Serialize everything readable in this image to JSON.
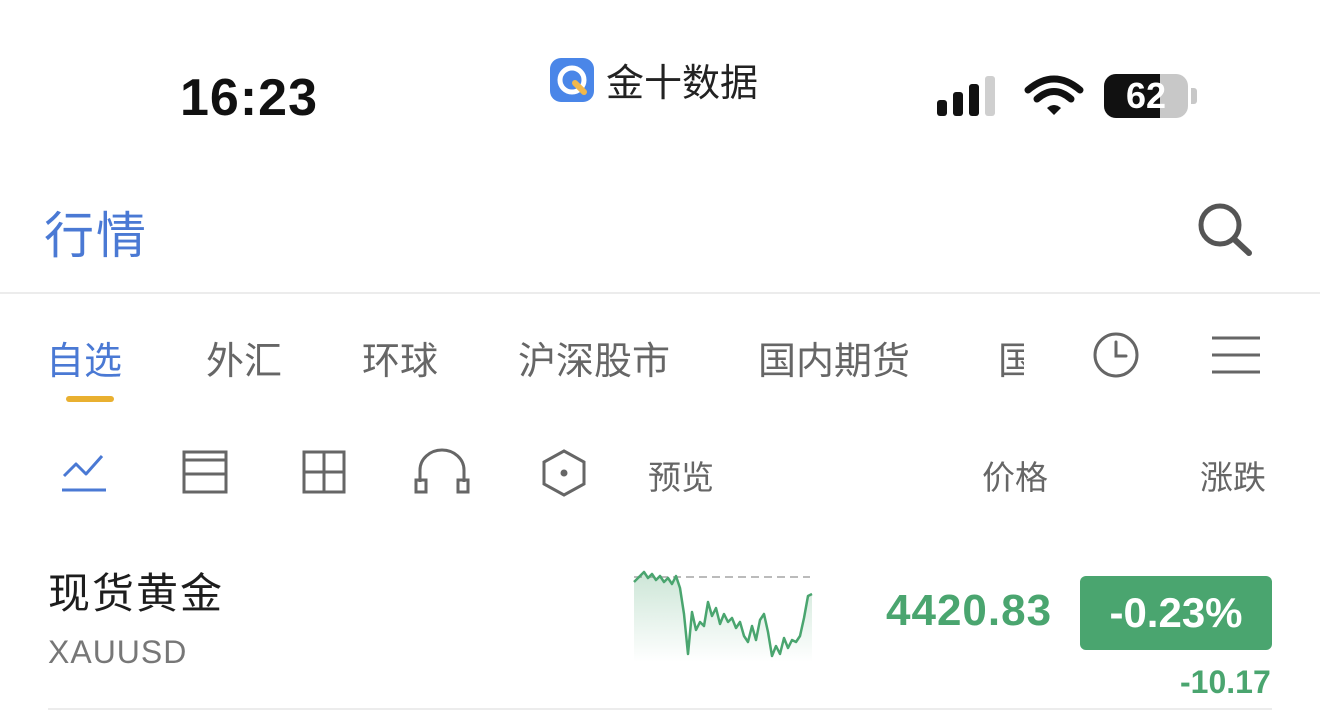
{
  "status_bar": {
    "time": "16:23",
    "app_name": "金十数据",
    "battery_level": "62"
  },
  "header": {
    "title": "行情",
    "search_icon": "search-icon"
  },
  "tabs": [
    {
      "label": "自选",
      "active": true
    },
    {
      "label": "外汇",
      "active": false
    },
    {
      "label": "环球",
      "active": false
    },
    {
      "label": "沪深股市",
      "active": false
    },
    {
      "label": "国内期货",
      "active": false
    },
    {
      "label": "国",
      "active": false
    }
  ],
  "tab_icons": [
    "clock-icon",
    "menu-icon"
  ],
  "view_tools": [
    "line-chart-icon",
    "split-view-icon",
    "grid-view-icon",
    "arc-view-icon",
    "hexagon-view-icon"
  ],
  "columns": {
    "preview": "预览",
    "price": "价格",
    "change": "涨跌"
  },
  "rows": [
    {
      "name": "现货黄金",
      "code": "XAUUSD",
      "price": "4420.83",
      "change_pct": "-0.23%",
      "change_abs": "-10.17"
    }
  ],
  "colors": {
    "accent": "#4a79d4",
    "tab_underline": "#e9b030",
    "down": "#4aa56f"
  }
}
